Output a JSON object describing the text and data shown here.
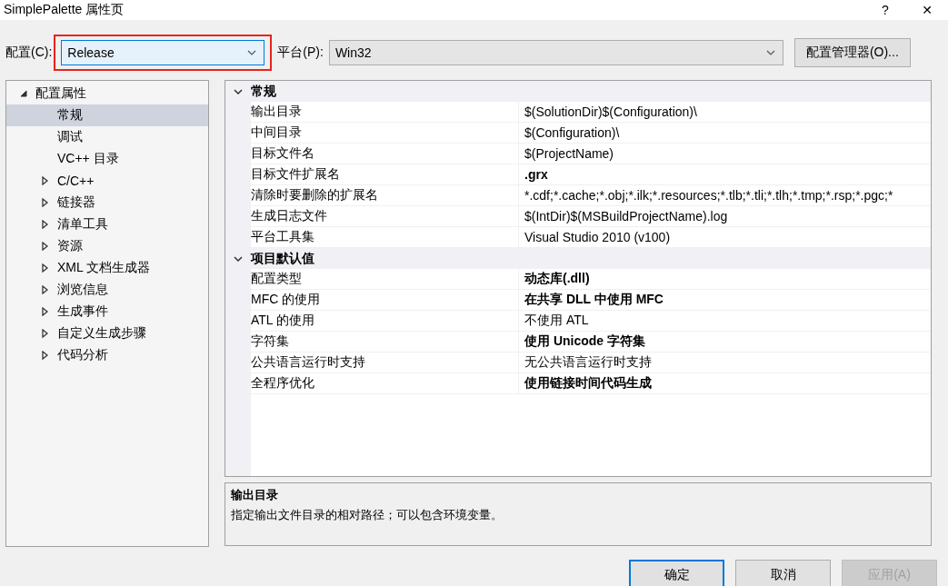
{
  "window": {
    "title": "SimplePalette 属性页",
    "help": "?",
    "close": "✕"
  },
  "toolbar": {
    "config_label": "配置(C):",
    "config_value": "Release",
    "config_highlighted": true,
    "platform_label": "平台(P):",
    "platform_value": "Win32",
    "manager_button": "配置管理器(O)..."
  },
  "tree": [
    {
      "label": "配置属性",
      "expanded": true,
      "selected": false,
      "children": [
        {
          "label": "常规",
          "selected": true,
          "expandable": false
        },
        {
          "label": "调试",
          "selected": false,
          "expandable": false
        },
        {
          "label": "VC++ 目录",
          "selected": false,
          "expandable": false
        },
        {
          "label": "C/C++",
          "selected": false,
          "expandable": true
        },
        {
          "label": "链接器",
          "selected": false,
          "expandable": true
        },
        {
          "label": "清单工具",
          "selected": false,
          "expandable": true
        },
        {
          "label": "资源",
          "selected": false,
          "expandable": true
        },
        {
          "label": "XML 文档生成器",
          "selected": false,
          "expandable": true
        },
        {
          "label": "浏览信息",
          "selected": false,
          "expandable": true
        },
        {
          "label": "生成事件",
          "selected": false,
          "expandable": true
        },
        {
          "label": "自定义生成步骤",
          "selected": false,
          "expandable": true
        },
        {
          "label": "代码分析",
          "selected": false,
          "expandable": true
        }
      ]
    }
  ],
  "grid": [
    {
      "section": "常规",
      "expanded": true,
      "rows": [
        {
          "name": "输出目录",
          "value": "$(SolutionDir)$(Configuration)\\",
          "bold": false,
          "selected": false
        },
        {
          "name": "中间目录",
          "value": "$(Configuration)\\",
          "bold": false,
          "selected": false
        },
        {
          "name": "目标文件名",
          "value": "$(ProjectName)",
          "bold": false,
          "selected": false
        },
        {
          "name": "目标文件扩展名",
          "value": ".grx",
          "bold": true,
          "selected": false
        },
        {
          "name": "清除时要删除的扩展名",
          "value": "*.cdf;*.cache;*.obj;*.ilk;*.resources;*.tlb;*.tli;*.tlh;*.tmp;*.rsp;*.pgc;*",
          "bold": false,
          "selected": false
        },
        {
          "name": "生成日志文件",
          "value": "$(IntDir)$(MSBuildProjectName).log",
          "bold": false,
          "selected": false
        },
        {
          "name": "平台工具集",
          "value": "Visual Studio 2010 (v100)",
          "bold": false,
          "selected": false
        }
      ]
    },
    {
      "section": "项目默认值",
      "expanded": true,
      "rows": [
        {
          "name": "配置类型",
          "value": "动态库(.dll)",
          "bold": true,
          "selected": false
        },
        {
          "name": "MFC 的使用",
          "value": "在共享 DLL 中使用 MFC",
          "bold": true,
          "selected": false
        },
        {
          "name": "ATL 的使用",
          "value": "不使用 ATL",
          "bold": false,
          "selected": false
        },
        {
          "name": "字符集",
          "value": "使用 Unicode 字符集",
          "bold": true,
          "selected": false
        },
        {
          "name": "公共语言运行时支持",
          "value": "无公共语言运行时支持",
          "bold": false,
          "selected": false
        },
        {
          "name": "全程序优化",
          "value": "使用链接时间代码生成",
          "bold": true,
          "selected": false
        }
      ]
    }
  ],
  "description": {
    "title": "输出目录",
    "text": "指定输出文件目录的相对路径；可以包含环境变量。"
  },
  "buttons": [
    {
      "label": "确定",
      "default": true,
      "disabled": false
    },
    {
      "label": "取消",
      "default": false,
      "disabled": false
    },
    {
      "label": "应用(A)",
      "default": false,
      "disabled": true
    }
  ]
}
